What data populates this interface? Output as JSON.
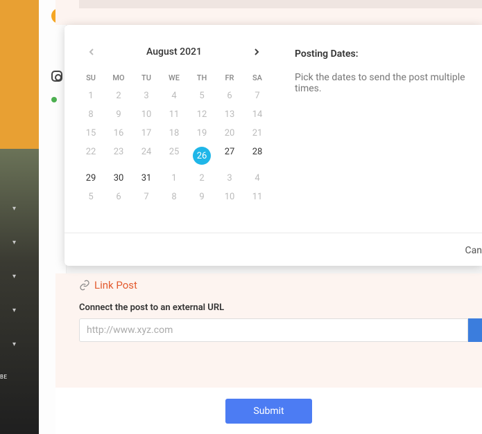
{
  "calendar": {
    "title": "August 2021",
    "dow": [
      "SU",
      "MO",
      "TU",
      "WE",
      "TH",
      "FR",
      "SA"
    ],
    "weeks": [
      [
        {
          "d": "1"
        },
        {
          "d": "2"
        },
        {
          "d": "3"
        },
        {
          "d": "4"
        },
        {
          "d": "5"
        },
        {
          "d": "6"
        },
        {
          "d": "7"
        }
      ],
      [
        {
          "d": "8"
        },
        {
          "d": "9"
        },
        {
          "d": "10"
        },
        {
          "d": "11"
        },
        {
          "d": "12"
        },
        {
          "d": "13"
        },
        {
          "d": "14"
        }
      ],
      [
        {
          "d": "15"
        },
        {
          "d": "16"
        },
        {
          "d": "17"
        },
        {
          "d": "18"
        },
        {
          "d": "19"
        },
        {
          "d": "20"
        },
        {
          "d": "21"
        }
      ],
      [
        {
          "d": "22"
        },
        {
          "d": "23"
        },
        {
          "d": "24"
        },
        {
          "d": "25"
        },
        {
          "d": "26",
          "sel": true
        },
        {
          "d": "27",
          "in": true
        },
        {
          "d": "28",
          "in": true
        }
      ],
      [
        {
          "d": "29",
          "in": true
        },
        {
          "d": "30",
          "in": true
        },
        {
          "d": "31",
          "in": true
        },
        {
          "d": "1"
        },
        {
          "d": "2"
        },
        {
          "d": "3"
        },
        {
          "d": "4"
        }
      ],
      [
        {
          "d": "5"
        },
        {
          "d": "6"
        },
        {
          "d": "7"
        },
        {
          "d": "8"
        },
        {
          "d": "9"
        },
        {
          "d": "10"
        },
        {
          "d": "11"
        }
      ]
    ]
  },
  "posting": {
    "title": "Posting Dates:",
    "desc": "Pick the dates to send the post multiple times."
  },
  "modal": {
    "cancel": "Can"
  },
  "linkpost": {
    "header": "Link Post",
    "label": "Connect the post to an external URL",
    "placeholder": "http://www.xyz.com"
  },
  "footer": {
    "submit": "Submit"
  },
  "sidebar": {
    "label": "BE"
  }
}
